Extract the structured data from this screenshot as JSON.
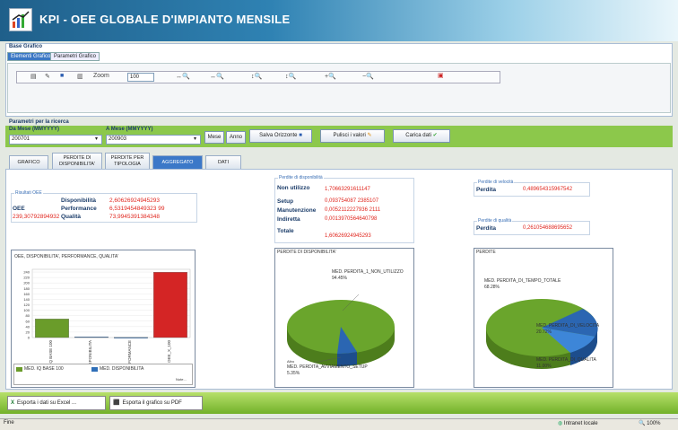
{
  "header": {
    "title": "KPI - OEE GLOBALE D'IMPIANTO MENSILE"
  },
  "chart_section": {
    "title": "Base Grafico",
    "tabs": [
      {
        "label": "Elementi Grafico"
      },
      {
        "label": "Parametri Grafico"
      }
    ],
    "toolbar": {
      "zoom_label": "Zoom",
      "zoom_value": "100"
    }
  },
  "search": {
    "title": "Parametri per la ricerca",
    "from_label": "Da Mese (MMYYYY)",
    "from_value": "200701",
    "to_label": "A Mese (MMYYYY)",
    "to_value": "200903",
    "mese_btn": "Mese",
    "anno_btn": "Anno",
    "save_btn": "Salva Orizzonte",
    "clear_btn": "Pulisci i valori",
    "load_btn": "Carica dati"
  },
  "main_tabs": [
    {
      "label": "GRAFICO"
    },
    {
      "label": "PERDITE DI DISPONIBILITA'"
    },
    {
      "label": "PERDITE PER TIPOLOGIA"
    },
    {
      "label": "AGGREGATO"
    },
    {
      "label": "DATI"
    }
  ],
  "oee_results": {
    "legend": "Risultati OEE",
    "oee_label": "OEE",
    "oee_value": "239,30792894932",
    "rows": [
      {
        "label": "Disponibilità",
        "value": "2,60626924945293"
      },
      {
        "label": "Performance",
        "value": "6,5319454849323 99"
      },
      {
        "label": "Qualità",
        "value": "73,9945391384348"
      }
    ]
  },
  "availability_losses": {
    "legend": "Perdite di disponibilità",
    "rows": [
      {
        "label": "Non utilizzo",
        "value": "1,70663291611147"
      },
      {
        "label": "Setup",
        "value": "0,093754087 2385107"
      },
      {
        "label": "Manutenzione",
        "value": "0,0052112227936 2111"
      },
      {
        "label": "Indiretta",
        "value": "0,0013970564640798"
      },
      {
        "label": "Totale",
        "value": "1,60626924945293"
      }
    ]
  },
  "speed_losses": {
    "legend": "Perdite di velocità",
    "label": "Perdita",
    "value": "0,489654315967542"
  },
  "quality_losses": {
    "legend": "Perdite di qualità",
    "label": "Perdita",
    "value": "0,261054688695652"
  },
  "bar_chart": {
    "title": "OEE, DISPONIBILITA', PERFORMANCE, QUALITA'"
  },
  "pie1": {
    "title": "PERDITE DI DISPONIBILITA'",
    "label_top": "MED. PERDITA_1_NON_UTILIZZO",
    "pct_top": "94.45%",
    "label_bottom": "MED. PERDITA_AVVIAMENTO_SETUP",
    "pct_bottom": "5.35%",
    "label_small": "Altro"
  },
  "pie2": {
    "title": "PERDITE",
    "label_1": "MED. PERDITA_DI_TEMPO_TOTALE",
    "pct_1": "68.28%",
    "label_2": "MED. PERDITA_DI_VELOCITA",
    "pct_2": "20.72%",
    "label_3": "MED. PERDITA_DI_QUALITA",
    "pct_3": "11.00%"
  },
  "chart_data": {
    "type": "bar",
    "title": "OEE, DISPONIBILITA', PERFORMANCE, QUALITA'",
    "categories": [
      "IQ BASE 100",
      "DISPONIBILITA",
      "PERFORMANCE",
      "OEE_X_100"
    ],
    "values": [
      68,
      2.6,
      0.5,
      239.3
    ],
    "colors": [
      "#6a9c2a",
      "#2f6fb8",
      "#2f6fb8",
      "#d42525"
    ],
    "ylim": [
      0,
      250
    ],
    "yticks": [
      "0",
      "20",
      "40",
      "60",
      "80",
      "100",
      "120",
      "140",
      "160",
      "180",
      "200",
      "220",
      "240"
    ],
    "legend": [
      "MED. IQ BASE 100",
      "MED. DISPONIBILITA"
    ],
    "legend_footer": "Note..."
  },
  "footer": {
    "excel_btn": "Esporta i dati su Excel ...",
    "pdf_btn": "Esporta il grafico su PDF"
  },
  "status": {
    "left": "Fine",
    "zone": "Intranet locale",
    "zoom": "100%"
  }
}
